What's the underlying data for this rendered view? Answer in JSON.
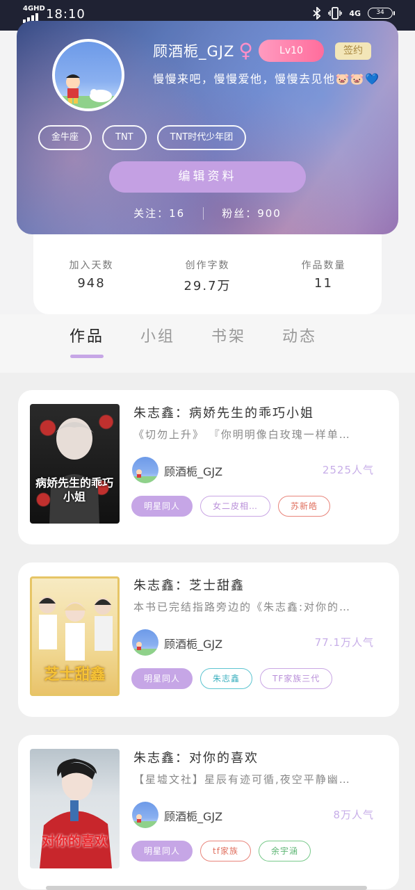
{
  "status": {
    "network": "4GHD",
    "time": "18:10",
    "network2": "4G",
    "battery": "34"
  },
  "profile": {
    "username": "顾酒栀_GJZ",
    "gender_symbol": "♀",
    "level": "Lv10",
    "signed": "签约",
    "bio": "慢慢来吧，慢慢爱他，慢慢去见他🐷🐷💙",
    "tags": [
      "金牛座",
      "TNT",
      "TNT时代少年团"
    ],
    "edit_label": "编辑资料",
    "following_label": "关注：16",
    "fans_label": "粉丝：900"
  },
  "stats": [
    {
      "label": "加入天数",
      "value": "948"
    },
    {
      "label": "创作字数",
      "value": "29.7万"
    },
    {
      "label": "作品数量",
      "value": "11"
    }
  ],
  "tabs": [
    "作品",
    "小组",
    "书架",
    "动态"
  ],
  "books": [
    {
      "title": "朱志鑫：病娇先生的乖巧小姐",
      "desc": "《切勿上升》 『你明明像白玫瑰一样单…",
      "author": "顾酒栀_GJZ",
      "popularity": "2525人气",
      "tags": [
        {
          "text": "明星同人",
          "color": "#c6a6e6",
          "filled": true
        },
        {
          "text": "女二皮相…",
          "color": "#c9a6e4",
          "filled": false
        },
        {
          "text": "苏新皓",
          "color": "#e8847a",
          "filled": false
        }
      ],
      "cover_text": "病娇先生的乖巧小姐"
    },
    {
      "title": "朱志鑫：芝士甜鑫",
      "desc": "本书已完结指路旁边的《朱志鑫:对你的…",
      "author": "顾酒栀_GJZ",
      "popularity": "77.1万人气",
      "tags": [
        {
          "text": "明星同人",
          "color": "#c6a6e6",
          "filled": true
        },
        {
          "text": "朱志鑫",
          "color": "#5cc4d0",
          "filled": false
        },
        {
          "text": "TF家族三代",
          "color": "#c9a6e4",
          "filled": false
        }
      ],
      "cover_text": "芝士甜鑫"
    },
    {
      "title": "朱志鑫：对你的喜欢",
      "desc": "【星墟文社】星辰有迹可循,夜空平静幽…",
      "author": "顾酒栀_GJZ",
      "popularity": "8万人气",
      "tags": [
        {
          "text": "明星同人",
          "color": "#c6a6e6",
          "filled": true
        },
        {
          "text": "tf家族",
          "color": "#e8847a",
          "filled": false
        },
        {
          "text": "余宇涵",
          "color": "#78c98a",
          "filled": false
        }
      ],
      "cover_text": "对你的喜欢"
    }
  ]
}
